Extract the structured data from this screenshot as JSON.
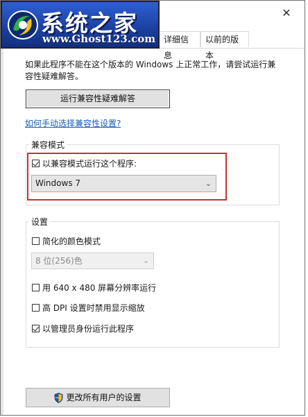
{
  "window": {
    "close_glyph": "✕",
    "tabs": [
      {
        "label": "详细信息"
      },
      {
        "label": "以前的版本"
      }
    ]
  },
  "logo": {
    "title": "系统之家",
    "url": "www.Ghost123.com"
  },
  "intro_text": "如果此程序不能在这个版本的 Windows 上正常工作，请尝试运行兼容性疑难解答。",
  "troubleshoot_button": "运行兼容性疑难解答",
  "help_link": "如何手动选择兼容性设置?",
  "compat_group": {
    "label": "兼容模式",
    "checkbox_label": "以兼容模式运行这个程序:",
    "checked": true,
    "os_select_value": "Windows 7"
  },
  "settings_group": {
    "label": "设置",
    "reduced_color": {
      "label": "简化的颜色模式",
      "checked": false
    },
    "color_select_value": "8 位(256)色",
    "res_640": {
      "label": "用 640 x 480 屏幕分辨率运行",
      "checked": false
    },
    "high_dpi": {
      "label": "高 DPI 设置时禁用显示缩放",
      "checked": false
    },
    "run_admin": {
      "label": "以管理员身份运行此程序",
      "checked": true
    }
  },
  "all_users_button": "更改所有用户的设置",
  "icons": {
    "close": "close-icon",
    "dropdown": "chevron-down-icon",
    "shield": "uac-shield-icon",
    "logo": "ghost-logo-icon"
  },
  "colors": {
    "highlight_border": "#c4322f",
    "link": "#1a5fb4",
    "logo_blue": "#2a57b7"
  }
}
